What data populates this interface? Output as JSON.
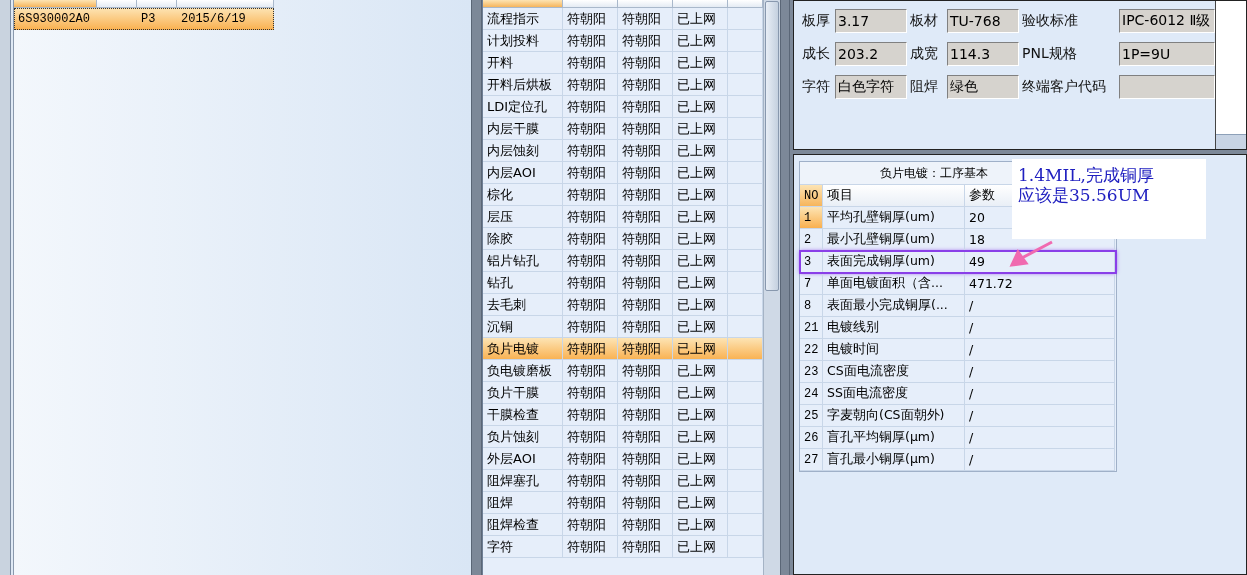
{
  "order_table": {
    "rows": [
      {
        "column_1": "6S930002A0",
        "column_3": "P3",
        "column_4": "2015/6/19",
        "selected": true
      }
    ]
  },
  "process_table": {
    "rows": [
      {
        "column_1": "流程指示",
        "column_2": "符朝阳",
        "column_3": "符朝阳",
        "column_4": "已上网",
        "selected": false
      },
      {
        "column_1": "计划投料",
        "column_2": "符朝阳",
        "column_3": "符朝阳",
        "column_4": "已上网",
        "selected": false
      },
      {
        "column_1": "开料",
        "column_2": "符朝阳",
        "column_3": "符朝阳",
        "column_4": "已上网",
        "selected": false
      },
      {
        "column_1": "开料后烘板",
        "column_2": "符朝阳",
        "column_3": "符朝阳",
        "column_4": "已上网",
        "selected": false
      },
      {
        "column_1": "LDI定位孔",
        "column_2": "符朝阳",
        "column_3": "符朝阳",
        "column_4": "已上网",
        "selected": false
      },
      {
        "column_1": "内层干膜",
        "column_2": "符朝阳",
        "column_3": "符朝阳",
        "column_4": "已上网",
        "selected": false
      },
      {
        "column_1": "内层蚀刻",
        "column_2": "符朝阳",
        "column_3": "符朝阳",
        "column_4": "已上网",
        "selected": false
      },
      {
        "column_1": "内层AOI",
        "column_2": "符朝阳",
        "column_3": "符朝阳",
        "column_4": "已上网",
        "selected": false
      },
      {
        "column_1": "棕化",
        "column_2": "符朝阳",
        "column_3": "符朝阳",
        "column_4": "已上网",
        "selected": false
      },
      {
        "column_1": "层压",
        "column_2": "符朝阳",
        "column_3": "符朝阳",
        "column_4": "已上网",
        "selected": false
      },
      {
        "column_1": "除胶",
        "column_2": "符朝阳",
        "column_3": "符朝阳",
        "column_4": "已上网",
        "selected": false
      },
      {
        "column_1": "铝片钻孔",
        "column_2": "符朝阳",
        "column_3": "符朝阳",
        "column_4": "已上网",
        "selected": false
      },
      {
        "column_1": "钻孔",
        "column_2": "符朝阳",
        "column_3": "符朝阳",
        "column_4": "已上网",
        "selected": false
      },
      {
        "column_1": "去毛刺",
        "column_2": "符朝阳",
        "column_3": "符朝阳",
        "column_4": "已上网",
        "selected": false
      },
      {
        "column_1": "沉铜",
        "column_2": "符朝阳",
        "column_3": "符朝阳",
        "column_4": "已上网",
        "selected": false
      },
      {
        "column_1": "负片电镀",
        "column_2": "符朝阳",
        "column_3": "符朝阳",
        "column_4": "已上网",
        "selected": true
      },
      {
        "column_1": "负电镀磨板",
        "column_2": "符朝阳",
        "column_3": "符朝阳",
        "column_4": "已上网",
        "selected": false
      },
      {
        "column_1": "负片干膜",
        "column_2": "符朝阳",
        "column_3": "符朝阳",
        "column_4": "已上网",
        "selected": false
      },
      {
        "column_1": "干膜检查",
        "column_2": "符朝阳",
        "column_3": "符朝阳",
        "column_4": "已上网",
        "selected": false
      },
      {
        "column_1": "负片蚀刻",
        "column_2": "符朝阳",
        "column_3": "符朝阳",
        "column_4": "已上网",
        "selected": false
      },
      {
        "column_1": "外层AOI",
        "column_2": "符朝阳",
        "column_3": "符朝阳",
        "column_4": "已上网",
        "selected": false
      },
      {
        "column_1": "阻焊塞孔",
        "column_2": "符朝阳",
        "column_3": "符朝阳",
        "column_4": "已上网",
        "selected": false
      },
      {
        "column_1": "阻焊",
        "column_2": "符朝阳",
        "column_3": "符朝阳",
        "column_4": "已上网",
        "selected": false
      },
      {
        "column_1": "阻焊检查",
        "column_2": "符朝阳",
        "column_3": "符朝阳",
        "column_4": "已上网",
        "selected": false
      },
      {
        "column_1": "字符",
        "column_2": "符朝阳",
        "column_3": "符朝阳",
        "column_4": "已上网",
        "selected": false
      }
    ]
  },
  "info_form": {
    "rows": [
      [
        {
          "label": "板厚",
          "value": "3.17"
        },
        {
          "label": "板材",
          "value": "TU-768"
        },
        {
          "label": "验收标准",
          "value": "IPC-6012 Ⅱ级"
        }
      ],
      [
        {
          "label": "成长",
          "value": "203.2"
        },
        {
          "label": "成宽",
          "value": "114.3"
        },
        {
          "label": "PNL规格",
          "value": "1P=9U"
        }
      ],
      [
        {
          "label": "字符",
          "value": "白色字符"
        },
        {
          "label": "阻焊",
          "value": "绿色"
        },
        {
          "label": "终端客户代码"
        }
      ]
    ]
  },
  "param_panel": {
    "title": "负片电镀：工序基本",
    "columns": [
      "NO",
      "项目",
      "参数"
    ],
    "rows": [
      {
        "no": "1",
        "item": "平均孔壁铜厚(um)",
        "value": "20",
        "selected": true,
        "marked": false
      },
      {
        "no": "2",
        "item": "最小孔壁铜厚(um)",
        "value": "18",
        "selected": false,
        "marked": false
      },
      {
        "no": "3",
        "item": "表面完成铜厚(um)",
        "value": "49",
        "selected": false,
        "marked": true
      },
      {
        "no": "7",
        "item": "单面电镀面积（含...",
        "value": "471.72",
        "selected": false,
        "marked": false
      },
      {
        "no": "8",
        "item": "表面最小完成铜厚(...",
        "value": "/",
        "selected": false,
        "marked": false
      },
      {
        "no": "21",
        "item": "电镀线别",
        "value": "/",
        "selected": false,
        "marked": false
      },
      {
        "no": "22",
        "item": "电镀时间",
        "value": "/",
        "selected": false,
        "marked": false
      },
      {
        "no": "23",
        "item": "CS面电流密度",
        "value": "/",
        "selected": false,
        "marked": false
      },
      {
        "no": "24",
        "item": "SS面电流密度",
        "value": "/",
        "selected": false,
        "marked": false
      },
      {
        "no": "25",
        "item": "字麦朝向(CS面朝外)",
        "value": "/",
        "selected": false,
        "marked": false
      },
      {
        "no": "26",
        "item": "盲孔平均铜厚(μm)",
        "value": "/",
        "selected": false,
        "marked": false
      },
      {
        "no": "27",
        "item": "盲孔最小铜厚(μm)",
        "value": "/",
        "selected": false,
        "marked": false
      }
    ],
    "annotation": {
      "lines": [
        "1.4MIL,完成铜厚",
        "应该是35.56UM"
      ]
    }
  }
}
